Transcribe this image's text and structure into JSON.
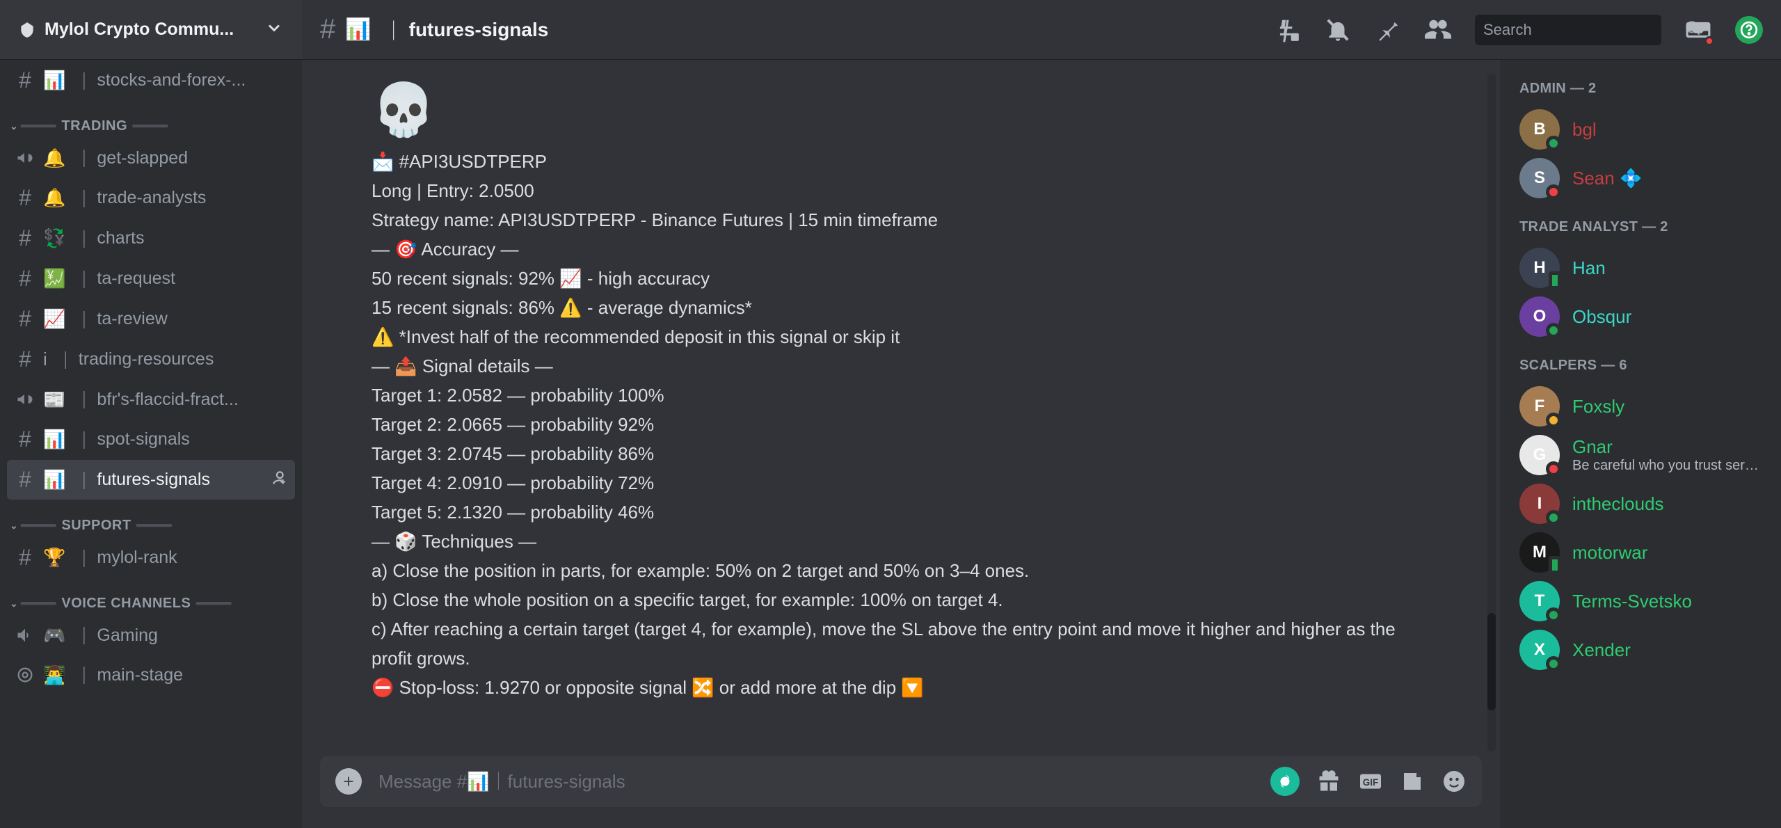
{
  "server": {
    "name": "Mylol Crypto Commu..."
  },
  "channels_top": [
    {
      "hash": "#",
      "emoji": "📊",
      "name": "stocks-and-forex-..."
    }
  ],
  "categories": [
    {
      "title": "TRADING",
      "items": [
        {
          "icon": "megaphone",
          "emoji": "🔔",
          "name": "get-slapped"
        },
        {
          "icon": "hash",
          "emoji": "🔔",
          "name": "trade-analysts"
        },
        {
          "icon": "hash",
          "emoji": "💱",
          "name": "charts"
        },
        {
          "icon": "hash",
          "emoji": "💹",
          "name": "ta-request"
        },
        {
          "icon": "hash",
          "emoji": "📈",
          "name": "ta-review"
        },
        {
          "icon": "hash",
          "emoji": "ℹ️",
          "name": "trading-resources",
          "emoji_raw": "i"
        },
        {
          "icon": "megaphone",
          "emoji": "📰",
          "name": "bfr's-flaccid-fract..."
        },
        {
          "icon": "hash",
          "emoji": "📊",
          "name": "spot-signals"
        },
        {
          "icon": "hash",
          "emoji": "📊",
          "name": "futures-signals",
          "active": true,
          "add_badge": true
        }
      ]
    },
    {
      "title": "SUPPORT",
      "items": [
        {
          "icon": "hash",
          "emoji": "🏆",
          "name": "mylol-rank"
        }
      ]
    },
    {
      "title": "VOICE CHANNELS",
      "items": [
        {
          "icon": "voice",
          "emoji": "🎮",
          "name": "Gaming"
        },
        {
          "icon": "stage",
          "emoji": "👨‍💻",
          "name": "main-stage"
        }
      ]
    }
  ],
  "header": {
    "emoji": "📊",
    "title": "futures-signals",
    "search_placeholder": "Search"
  },
  "message": {
    "skull": "💀",
    "l1": "📩 #API3USDTPERP",
    "l2": "Long | Entry: 2.0500",
    "l3": "Strategy name: API3USDTPERP - Binance Futures | 15 min timeframe",
    "l4": "",
    "l5": "— 🎯 Accuracy —",
    "l6": "50 recent signals: 92% 📈 - high accuracy",
    "l7": "15 recent signals: 86% ⚠️ - average dynamics*",
    "l8": "⚠️ *Invest half of the recommended deposit in this signal or skip it",
    "l9": "",
    "l10": "— 📤 Signal details —",
    "l11": "Target 1: 2.0582 — probability 100%",
    "l12": "Target 2: 2.0665 — probability 92%",
    "l13": "Target 3: 2.0745 — probability 86%",
    "l14": "Target 4: 2.0910 — probability 72%",
    "l15": "Target 5: 2.1320 — probability 46%",
    "l16": "",
    "l17": "— 🎲 Techniques —",
    "l18": "a) Close the position in parts, for example: 50% on 2 target and 50% on 3–4 ones.",
    "l19": "b) Close the whole position on a specific target, for example: 100% on target 4.",
    "l20": "c) After reaching a certain target (target 4, for example), move the SL above the entry point and move it higher and higher as the profit grows.",
    "l21": "",
    "l22": "⛔ Stop-loss: 1.9270 or opposite signal 🔀 or add more at the dip 🔽"
  },
  "input": {
    "placeholder": "Message #📊｜futures-signals"
  },
  "members": {
    "groups": [
      {
        "role": "ADMIN",
        "count": 2,
        "color": "c-red",
        "list": [
          {
            "name": "bgl",
            "avatar_color": "#8b6f47",
            "status": "online"
          },
          {
            "name": "Sean",
            "avatar_color": "#6b7b8c",
            "status": "dnd",
            "badge": "💠"
          }
        ]
      },
      {
        "role": "TRADE ANALYST",
        "count": 2,
        "color": "c-cyan",
        "list": [
          {
            "name": "Han",
            "avatar_color": "#3b4252",
            "status": "mobile"
          },
          {
            "name": "Obsqur",
            "avatar_color": "#6b3fa0",
            "status": "online"
          }
        ]
      },
      {
        "role": "SCALPERS",
        "count": 6,
        "color": "c-green",
        "list": [
          {
            "name": "Foxsly",
            "avatar_color": "#a67c52",
            "status": "idle"
          },
          {
            "name": "Gnar",
            "avatar_color": "#e8e8e8",
            "status": "dnd",
            "subtitle": "Be careful who you trust serg..."
          },
          {
            "name": "intheclouds",
            "avatar_color": "#8b3a3a",
            "status": "online"
          },
          {
            "name": "motorwar",
            "avatar_color": "#1a1a1a",
            "status": "mobile"
          },
          {
            "name": "Terms-Svetsko",
            "avatar_color": "#1abc9c",
            "status": "online"
          },
          {
            "name": "Xender",
            "avatar_color": "#1abc9c",
            "status": "online"
          }
        ]
      }
    ]
  }
}
